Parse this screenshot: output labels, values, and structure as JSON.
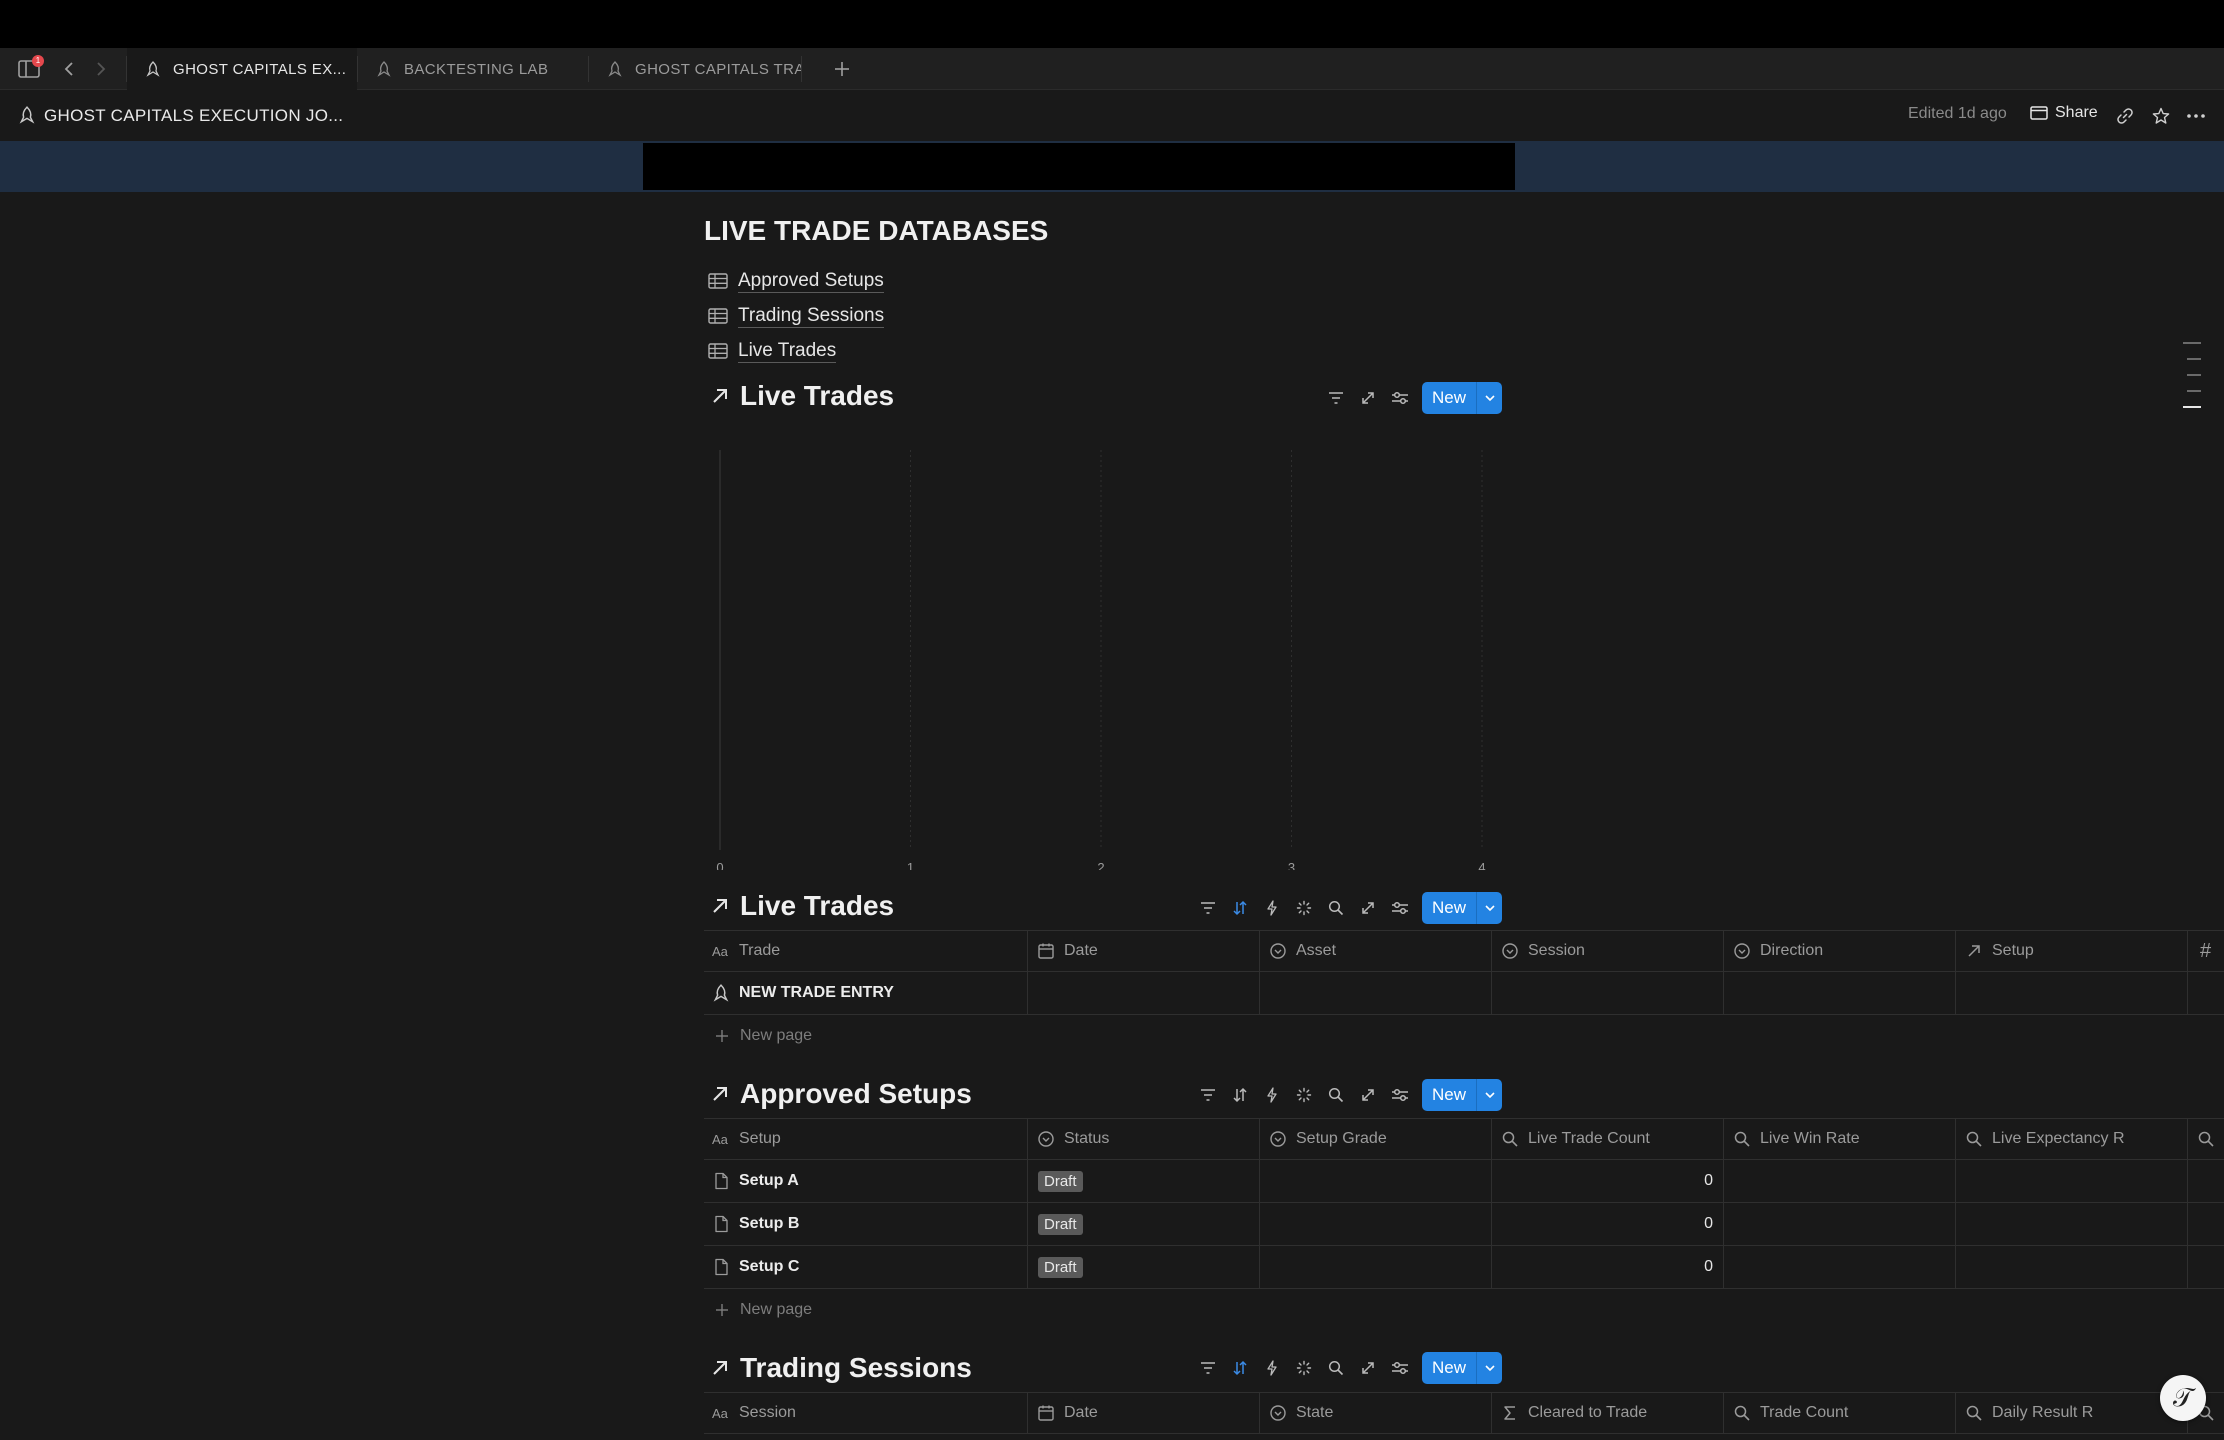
{
  "tabs": [
    {
      "label": "GHOST CAPITALS EX..."
    },
    {
      "label": "BACKTESTING LAB"
    },
    {
      "label": "GHOST CAPITALS TRA"
    }
  ],
  "notification_count": "1",
  "page": {
    "title": "GHOST CAPITALS EXECUTION JO...",
    "edited": "Edited 1d ago",
    "share_label": "Share"
  },
  "heading": "LIVE TRADE DATABASES",
  "db_links": [
    {
      "label": "Approved Setups"
    },
    {
      "label": "Trading Sessions"
    },
    {
      "label": "Live Trades"
    }
  ],
  "new_label": "New",
  "chart_section": {
    "title": "Live Trades"
  },
  "chart_data": {
    "type": "bar",
    "title": "",
    "x_ticks": [
      "0",
      "1",
      "2",
      "3",
      "4"
    ],
    "xlim": [
      0,
      4
    ],
    "values": [],
    "grid": "vertical dotted"
  },
  "live_trades": {
    "title": "Live Trades",
    "columns": [
      "Trade",
      "Date",
      "Asset",
      "Session",
      "Direction",
      "Setup",
      "#"
    ],
    "rows": [
      {
        "trade": "NEW TRADE ENTRY"
      }
    ],
    "new_page": "New page"
  },
  "approved_setups": {
    "title": "Approved Setups",
    "columns": [
      "Setup",
      "Status",
      "Setup Grade",
      "Live Trade Count",
      "Live Win Rate",
      "Live Expectancy R"
    ],
    "rows": [
      {
        "setup": "Setup A",
        "status": "Draft",
        "count": "0"
      },
      {
        "setup": "Setup B",
        "status": "Draft",
        "count": "0"
      },
      {
        "setup": "Setup C",
        "status": "Draft",
        "count": "0"
      }
    ],
    "new_page": "New page"
  },
  "trading_sessions": {
    "title": "Trading Sessions",
    "columns": [
      "Session",
      "Date",
      "State",
      "Cleared to Trade",
      "Trade Count",
      "Daily Result R"
    ]
  },
  "colors": {
    "accent": "#2383e2",
    "cover": "#1f2e42",
    "background": "#191919",
    "badge": "#5a5a5a"
  }
}
